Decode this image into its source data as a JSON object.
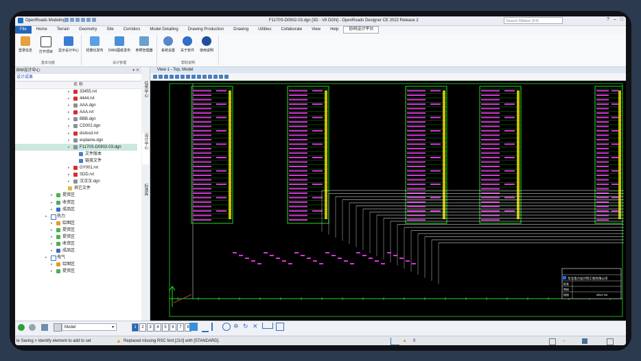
{
  "titlebar": {
    "app_name": "OpenRoads Modeling",
    "doc_title": "F1170S-D0902-03.dgn [3D - V8 DGN] - OpenRoads Designer CE 2022 Release 2",
    "search_placeholder": "Search Ribbon (F4)"
  },
  "menu": {
    "items": [
      "File",
      "Home",
      "Terrain",
      "Geometry",
      "Site",
      "Corridors",
      "Model Detailing",
      "Drawing Production",
      "Drawing",
      "Utilities",
      "Collaborate",
      "View",
      "Help",
      "协同设计平台"
    ]
  },
  "ribbon": {
    "groups": [
      {
        "label": "基本功能",
        "buttons": [
          "登录信息",
          "打开项目",
          "显示设计中心"
        ]
      },
      {
        "label": "设计管理",
        "buttons": [
          "轻量化发布",
          "DWG图纸发布",
          "参照管理器"
        ]
      },
      {
        "label": "帮助说明",
        "buttons": [
          "系统设置",
          "关于软件",
          "使用说明"
        ]
      }
    ]
  },
  "left_panel": {
    "title": "BIM设计中心",
    "tab": "设计成果",
    "column": "名 称",
    "rows": [
      {
        "text": "33455.rvt",
        "indent": 85,
        "icon": "revit"
      },
      {
        "text": "4444.rvt",
        "indent": 85,
        "icon": "revit"
      },
      {
        "text": "AAA.dgn",
        "indent": 85,
        "icon": "dgn"
      },
      {
        "text": "AAA.rvt",
        "indent": 85,
        "icon": "revit"
      },
      {
        "text": "BBB.dgn",
        "indent": 85,
        "icon": "dgn"
      },
      {
        "text": "CD002.dgn",
        "indent": 85,
        "icon": "dgn"
      },
      {
        "text": "dsdssd.rvt",
        "indent": 85,
        "icon": "revit"
      },
      {
        "text": "explame.dgn",
        "indent": 85,
        "icon": "dgn"
      },
      {
        "text": "F1170S-D0902-03.dgn",
        "indent": 85,
        "icon": "dgn",
        "selected": true
      },
      {
        "text": "文件版本",
        "indent": 93,
        "icon": "box"
      },
      {
        "text": "链接文件",
        "indent": 93,
        "icon": "box"
      },
      {
        "text": "GY001.rvt",
        "indent": 85,
        "icon": "revit"
      },
      {
        "text": "SDD.rvt",
        "indent": 85,
        "icon": "revit"
      },
      {
        "text": "汉汉汉.dgn",
        "indent": 85,
        "icon": "dgn"
      },
      {
        "text": "其它文件",
        "indent": 77,
        "icon": "folder"
      },
      {
        "text": "提资区",
        "indent": 60,
        "icon": "green"
      },
      {
        "text": "收资区",
        "indent": 60,
        "icon": "green"
      },
      {
        "text": "成品区",
        "indent": 60,
        "icon": "blue"
      },
      {
        "text": "热力",
        "indent": 52,
        "icon": "outline"
      },
      {
        "text": "绘图区",
        "indent": 60,
        "icon": "orange"
      },
      {
        "text": "提资区",
        "indent": 60,
        "icon": "green"
      },
      {
        "text": "提资区",
        "indent": 60,
        "icon": "green"
      },
      {
        "text": "收资区",
        "indent": 60,
        "icon": "green"
      },
      {
        "text": "成品区",
        "indent": 60,
        "icon": "blue"
      },
      {
        "text": "电气",
        "indent": 52,
        "icon": "outline"
      },
      {
        "text": "绘图区",
        "indent": 60,
        "icon": "orange"
      },
      {
        "text": "提资区",
        "indent": 60,
        "icon": "green"
      }
    ]
  },
  "side_tabs": [
    "任务中心",
    "设计中心",
    "标准库"
  ],
  "view": {
    "title": "View 1 - Top, Model"
  },
  "titleblock": {
    "company": "华北电力设计院工程有限公司",
    "row_labels": [
      "批准",
      "审核",
      "校核"
    ],
    "code": "2017.01"
  },
  "bottom_toolbar": {
    "model": "Model",
    "pages": [
      "1",
      "2",
      "3",
      "4",
      "5",
      "6",
      "7",
      "8"
    ]
  },
  "status": {
    "left": "le Saving > Identify element to add to set",
    "message": "Replaced missing RSC font [210] with [STANDARD].",
    "level": "0"
  },
  "colors": {
    "accent": "#2266b8",
    "cad_frame": "#22dd22",
    "cad_text": "#dd33dd",
    "cad_lines": "#ffffff"
  }
}
